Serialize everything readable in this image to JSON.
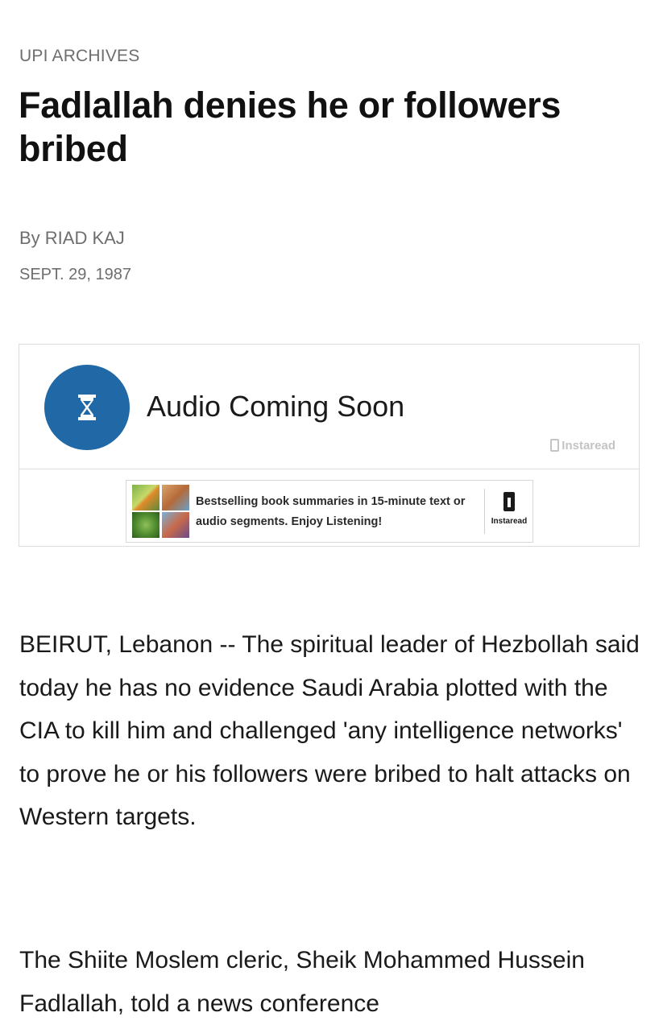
{
  "section_label": "UPI ARCHIVES",
  "headline": "Fadlallah denies he or followers bribed",
  "byline": "By RIAD KAJ",
  "date": "SEPT. 29, 1987",
  "audio": {
    "title": "Audio Coming Soon",
    "icon": "hourglass-icon",
    "brand": "Instaread",
    "accent_color": "#2068a6"
  },
  "ad": {
    "text": "Bestselling book summaries in 15-minute text or audio segments. Enjoy Listening!",
    "brand": "Instaread"
  },
  "article": {
    "paragraphs": [
      "BEIRUT, Lebanon -- The spiritual leader of Hezbollah said today he has no evidence Saudi Arabia plotted with the CIA to kill him and challenged 'any intelligence networks' to prove he or his followers were bribed to halt attacks on Western targets.",
      "The Shiite Moslem cleric, Sheik Mohammed Hussein Fadlallah, told a news conference"
    ]
  }
}
